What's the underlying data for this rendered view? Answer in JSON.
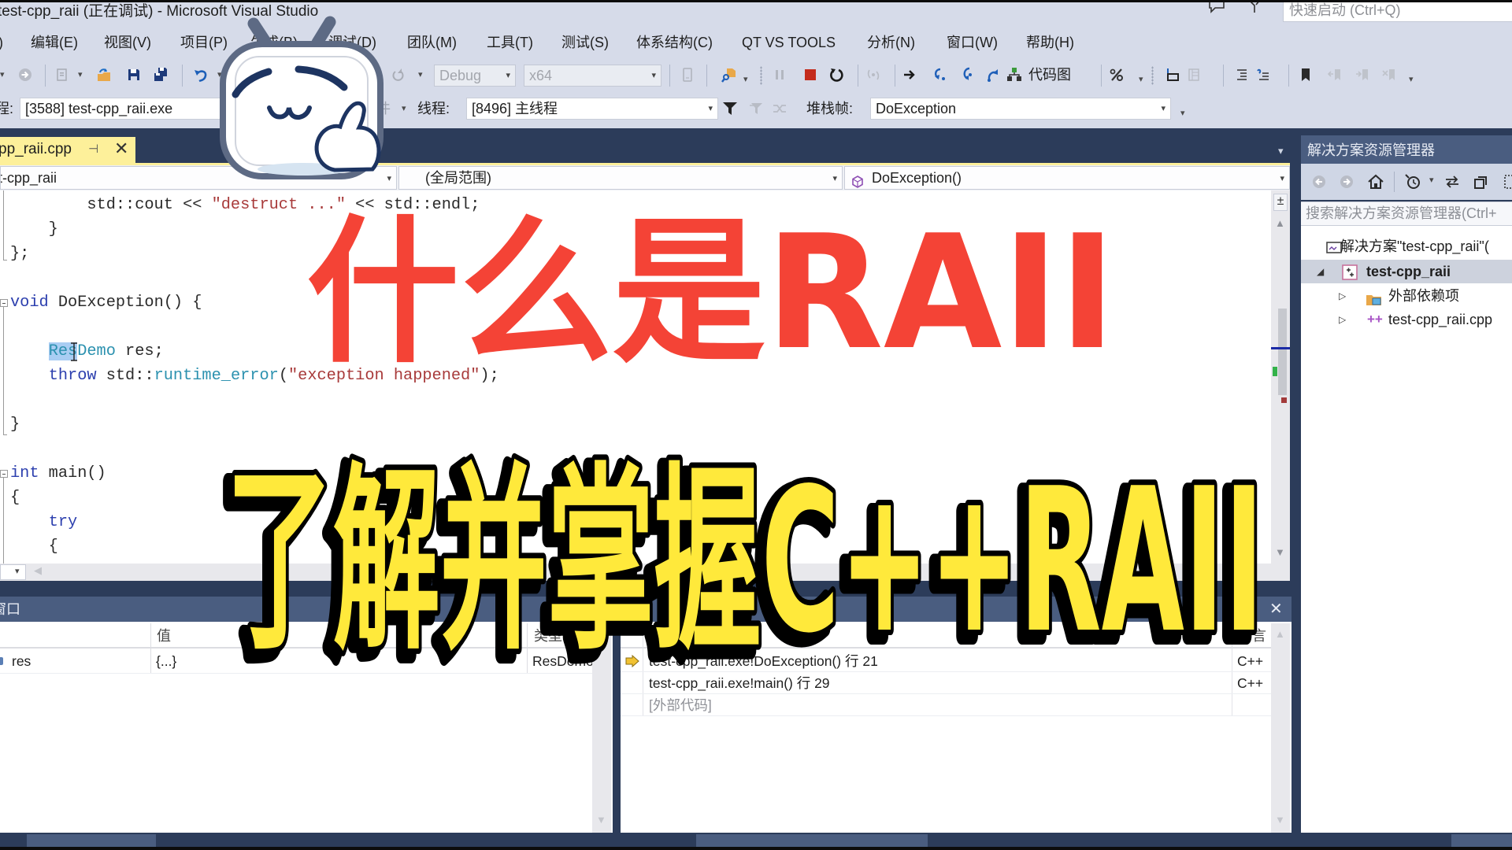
{
  "window": {
    "title": "test-cpp_raii (正在调试) - Microsoft Visual Studio",
    "quick_launch_placeholder": "快速启动 (Ctrl+Q)"
  },
  "menu": {
    "items": [
      ")",
      "编辑(E)",
      "视图(V)",
      "项目(P)",
      "生成(B)",
      "调试(D)",
      "团队(M)",
      "工具(T)",
      "测试(S)",
      "体系结构(C)",
      "QT VS TOOLS",
      "分析(N)",
      "窗口(W)",
      "帮助(H)"
    ]
  },
  "toolbar": {
    "solution_config": "Debug",
    "solution_platform": "x64",
    "code_map_label": "代码图"
  },
  "debug_location": {
    "process_label": "程:",
    "process_value": "[3588] test-cpp_raii.exe",
    "lifecycle_label": "件",
    "thread_label": "线程:",
    "thread_value": "[8496] 主线程",
    "stack_frame_label": "堆栈帧:",
    "stack_frame_value": "DoException"
  },
  "document_tab": {
    "label": "pp_raii.cpp",
    "close_glyph": "✕",
    "pin_glyph": "⊣"
  },
  "navigation_bar": {
    "project": "t-cpp_raii",
    "scope": "(全局范围)",
    "member": "DoException()"
  },
  "editor": {
    "selected_text": "Res",
    "lines": [
      [
        {
          "t": "        std::cout << "
        },
        {
          "t": "\"destruct ...\"",
          "c": "str"
        },
        {
          "t": " << std::endl;"
        }
      ],
      [
        {
          "t": "    }"
        }
      ],
      [
        {
          "t": "};"
        }
      ],
      [],
      [
        {
          "t": "void",
          "c": "kw"
        },
        {
          "t": " DoException() {"
        }
      ],
      [],
      [
        {
          "t": "    "
        },
        {
          "t": "Res",
          "c": "type",
          "sel": true
        },
        {
          "t": "Demo",
          "c": "type"
        },
        {
          "t": " res;"
        }
      ],
      [
        {
          "t": "    "
        },
        {
          "t": "throw",
          "c": "kw"
        },
        {
          "t": " std::"
        },
        {
          "t": "runtime_error",
          "c": "type"
        },
        {
          "t": "("
        },
        {
          "t": "\"exception happened\"",
          "c": "str"
        },
        {
          "t": ");"
        }
      ],
      [],
      [
        {
          "t": "}"
        }
      ],
      [],
      [
        {
          "t": "int",
          "c": "kw"
        },
        {
          "t": " main()"
        }
      ],
      [
        {
          "t": "{"
        }
      ],
      [
        {
          "t": "    "
        },
        {
          "t": "try",
          "c": "kw"
        }
      ],
      [
        {
          "t": "    {"
        }
      ]
    ]
  },
  "locals_window": {
    "title": "窗口",
    "columns": {
      "value": "值",
      "type": "类型"
    },
    "rows": [
      {
        "name": "res",
        "value": "{...}",
        "type": "ResDemo"
      }
    ]
  },
  "call_stack_window": {
    "columns": {
      "name": "名称",
      "language": "语言"
    },
    "rows": [
      {
        "name": "test-cpp_raii.exe!DoException() 行 21",
        "language": "C++",
        "current": true
      },
      {
        "name": "test-cpp_raii.exe!main() 行 29",
        "language": "C++"
      },
      {
        "name": "[外部代码]",
        "language": ""
      }
    ]
  },
  "solution_explorer": {
    "title": "解决方案资源管理器",
    "search_placeholder": "搜索解决方案资源管理器(Ctrl+",
    "tree": [
      {
        "label": "解决方案\"test-cpp_raii\"(",
        "icon": "solution-icon"
      },
      {
        "label": "test-cpp_raii",
        "icon": "project-icon",
        "expanded": true,
        "selected": true
      },
      {
        "label": "外部依赖项",
        "icon": "external-dependencies-icon",
        "expanded": false
      },
      {
        "label": "test-cpp_raii.cpp",
        "icon": "cpp-file-icon",
        "expanded": false
      }
    ]
  },
  "overlay": {
    "headline": "什么是RAII",
    "subheadline": "了解并掌握C++RAII",
    "headline_color": "#f44336",
    "subheadline_color": "#ffe93b",
    "outline_color": "#000000"
  }
}
